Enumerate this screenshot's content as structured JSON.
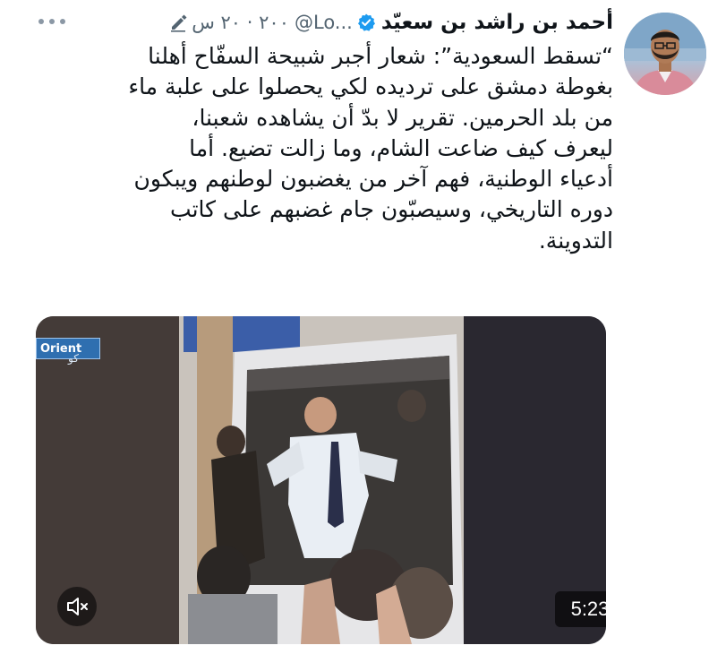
{
  "tweet": {
    "author": {
      "display_name": "أحمد بن راشد بن سعيّد",
      "verified": true,
      "handle": "@Lo...",
      "avatar_icon": "profile-photo"
    },
    "timestamp": "٢٠ س · ٢٠٠",
    "timestamp_parts": {
      "age": "٢٠ س",
      "prefix": "٢٠٠"
    },
    "icons": {
      "verified": "verified-badge-icon",
      "edit": "edit-pencil-icon",
      "more": "more-options-icon",
      "mute": "muted-speaker-icon"
    },
    "text_lines": [
      "“تسقط السعودية”: شعار أجبر شبيحة السفّاح أهلنا",
      "بغوطة دمشق على ترديده لكي يحصلوا على علبة ماء",
      "من بلد الحرمين. تقرير لا بدّ أن يشاهده شعبنا،",
      "ليعرف كيف ضاعت الشام، وما زالت تضيع. أما",
      "أدعياء الوطنية، فهم آخر من يغضبون لوطنهم ويبكون",
      "دوره التاريخي، وسيصبّون جام غضبهم على كاتب",
      "التدوينة."
    ],
    "media": {
      "type": "video",
      "duration": "5:23",
      "channel_logo_text": "Orient",
      "channel_logo_sub": "كو"
    }
  },
  "colors": {
    "text_primary": "#0f1419",
    "text_secondary": "#536471",
    "verified_blue": "#1d9bf0",
    "channel_blue": "#2f6fb0"
  }
}
